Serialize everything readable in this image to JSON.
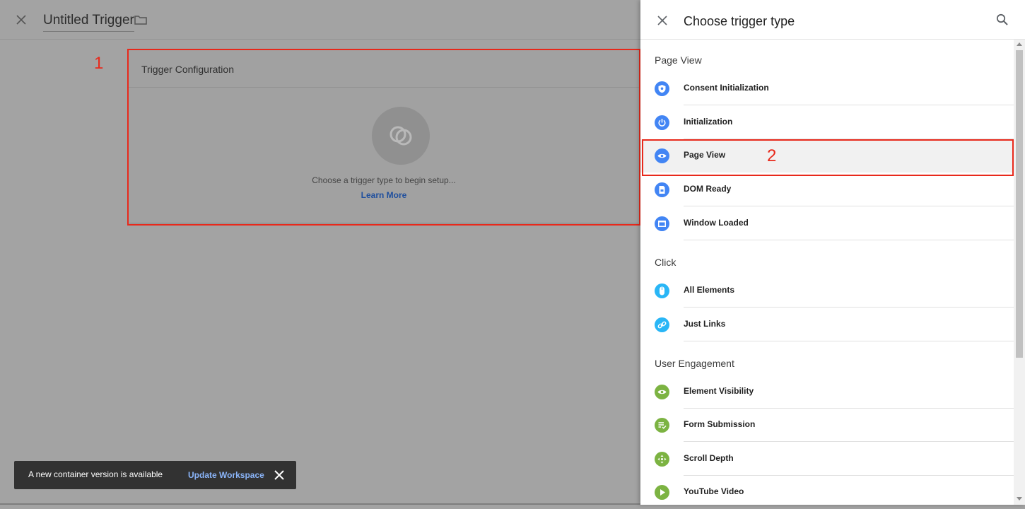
{
  "editor": {
    "title": "Untitled Trigger",
    "card_title": "Trigger Configuration",
    "card_help": "Choose a trigger type to begin setup...",
    "card_link": "Learn More"
  },
  "annotations": {
    "one": "1",
    "two": "2"
  },
  "snackbar": {
    "message": "A new container version is available",
    "action": "Update Workspace"
  },
  "panel": {
    "title": "Choose trigger type",
    "sections": [
      {
        "label": "Page View",
        "items": [
          {
            "label": "Consent Initialization",
            "icon": "shield-icon"
          },
          {
            "label": "Initialization",
            "icon": "power-icon"
          },
          {
            "label": "Page View",
            "icon": "eye-icon"
          },
          {
            "label": "DOM Ready",
            "icon": "document-icon"
          },
          {
            "label": "Window Loaded",
            "icon": "window-icon"
          }
        ]
      },
      {
        "label": "Click",
        "items": [
          {
            "label": "All Elements",
            "icon": "mouse-icon"
          },
          {
            "label": "Just Links",
            "icon": "link-icon"
          }
        ]
      },
      {
        "label": "User Engagement",
        "items": [
          {
            "label": "Element Visibility",
            "icon": "eye-icon"
          },
          {
            "label": "Form Submission",
            "icon": "form-icon"
          },
          {
            "label": "Scroll Depth",
            "icon": "move-icon"
          },
          {
            "label": "YouTube Video",
            "icon": "play-icon"
          }
        ]
      }
    ]
  },
  "colors": {
    "page_view_icon": "#4285f4",
    "click_icon": "#29b6f6",
    "engagement_icon": "#7cb342",
    "annotation": "#e8291b"
  }
}
